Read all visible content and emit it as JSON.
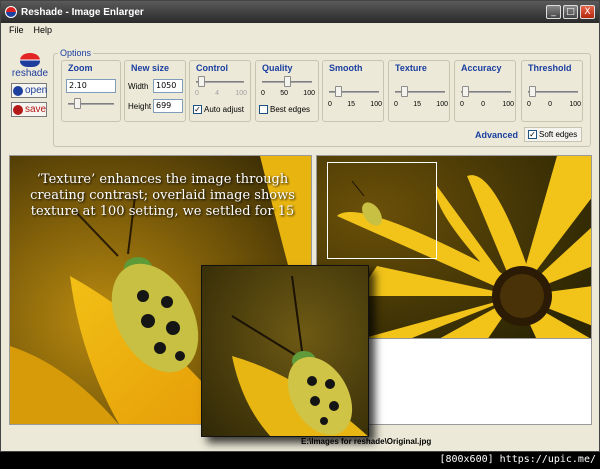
{
  "window": {
    "title": "Reshade - Image Enlarger",
    "buttons": [
      "_",
      "□",
      "X"
    ]
  },
  "menu": [
    "File",
    "Help"
  ],
  "brand": {
    "logo_text": "reshade",
    "open_label": "open",
    "save_label": "save"
  },
  "options": {
    "legend": "Options",
    "zoom": {
      "label": "Zoom",
      "value": "2.10"
    },
    "new_size": {
      "label": "New size",
      "width_label": "Width",
      "width_value": "1050",
      "height_label": "Height",
      "height_value": "699"
    },
    "control": {
      "label": "Control",
      "ticks": [
        "0",
        "4",
        "100"
      ],
      "auto_adjust_label": "Auto adjust",
      "auto_adjust_checked": true
    },
    "quality": {
      "label": "Quality",
      "ticks": [
        "0",
        "50",
        "100"
      ],
      "best_edges_label": "Best edges",
      "best_edges_checked": false
    },
    "smooth": {
      "label": "Smooth",
      "ticks": [
        "0",
        "15",
        "100"
      ]
    },
    "texture": {
      "label": "Texture",
      "ticks": [
        "0",
        "15",
        "100"
      ]
    },
    "accuracy": {
      "label": "Accuracy",
      "ticks": [
        "0",
        "0",
        "100"
      ]
    },
    "threshold": {
      "label": "Threshold",
      "ticks": [
        "0",
        "0",
        "100"
      ]
    },
    "advanced_label": "Advanced",
    "soft_edges_label": "Soft edges",
    "soft_edges_checked": true
  },
  "overlay_text": "‘Texture’ enhances the image through creating contrast; overlaid image shows texture at 100 setting, we settled for 15",
  "status": {
    "path": "E:\\Images for reshade\\Original.jpg"
  },
  "watermark": "[800x600] https://upic.me/",
  "colors": {
    "accent": "#1a3ea0",
    "brand_red": "#b41818",
    "titlebar": "#3a3a3a"
  }
}
